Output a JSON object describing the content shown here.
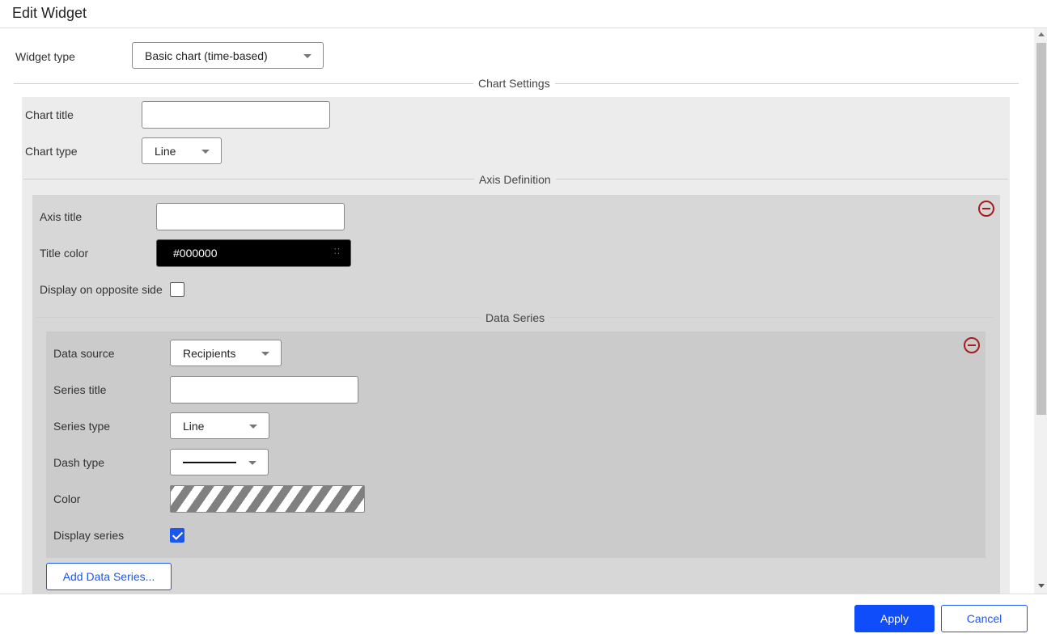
{
  "dialog": {
    "title": "Edit Widget"
  },
  "widget_type": {
    "label": "Widget type",
    "value": "Basic chart (time-based)"
  },
  "chart_settings": {
    "section_title": "Chart Settings",
    "chart_title_label": "Chart title",
    "chart_title_value": "",
    "chart_type_label": "Chart type",
    "chart_type_value": "Line"
  },
  "axis_definition": {
    "section_title": "Axis Definition",
    "axis_title_label": "Axis title",
    "axis_title_value": "",
    "title_color_label": "Title color",
    "title_color_value": "#000000",
    "opposite_side_label": "Display on opposite side",
    "opposite_side_checked": false
  },
  "data_series": {
    "section_title": "Data Series",
    "data_source_label": "Data source",
    "data_source_value": "Recipients",
    "series_title_label": "Series title",
    "series_title_value": "",
    "series_type_label": "Series type",
    "series_type_value": "Line",
    "dash_type_label": "Dash type",
    "color_label": "Color",
    "display_series_label": "Display series",
    "display_series_checked": true,
    "add_button_label": "Add Data Series..."
  },
  "footer": {
    "apply_label": "Apply",
    "cancel_label": "Cancel"
  },
  "colors": {
    "primary": "#0f4dfa",
    "remove": "#a71d1d",
    "panel_level1": "#ececec",
    "panel_level2": "#d7d7d7",
    "panel_level3": "#cbcbcb"
  }
}
